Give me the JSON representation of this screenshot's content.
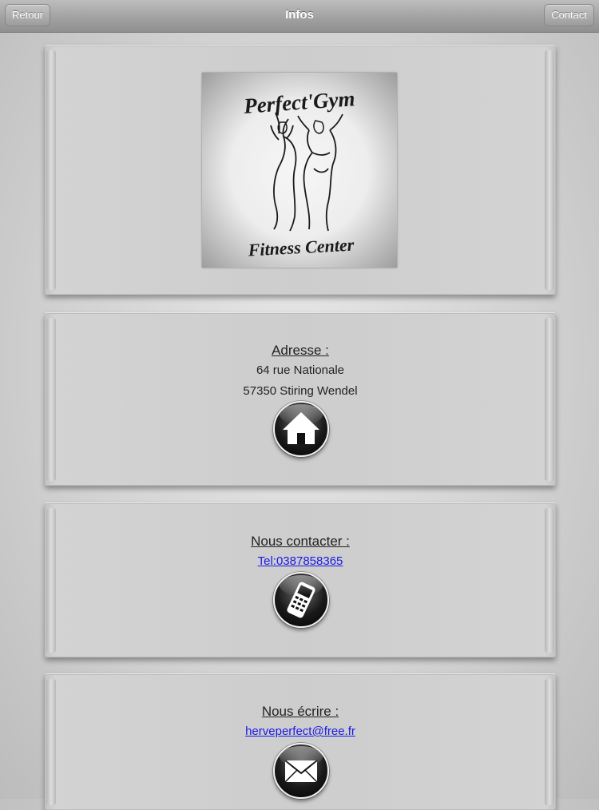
{
  "nav": {
    "back_label": "Retour",
    "title": "Infos",
    "contact_label": "Contact"
  },
  "logo": {
    "text_top": "Perfect'Gym",
    "text_bottom": "Fitness Center"
  },
  "address": {
    "heading": "Adresse :",
    "line1": "64 rue Nationale",
    "line2": "57350 Stiring Wendel",
    "icon": "home-icon"
  },
  "contact": {
    "heading": "Nous contacter :",
    "phone_link": "Tel:0387858365",
    "icon": "mobile-phone-icon"
  },
  "email": {
    "heading": "Nous écrire :",
    "email_link": "herveperfect@free.fr",
    "icon": "envelope-icon"
  },
  "colors": {
    "link": "#1a1ae6",
    "background": "#d2d2d2",
    "toolbar": "#a2a2a2"
  }
}
